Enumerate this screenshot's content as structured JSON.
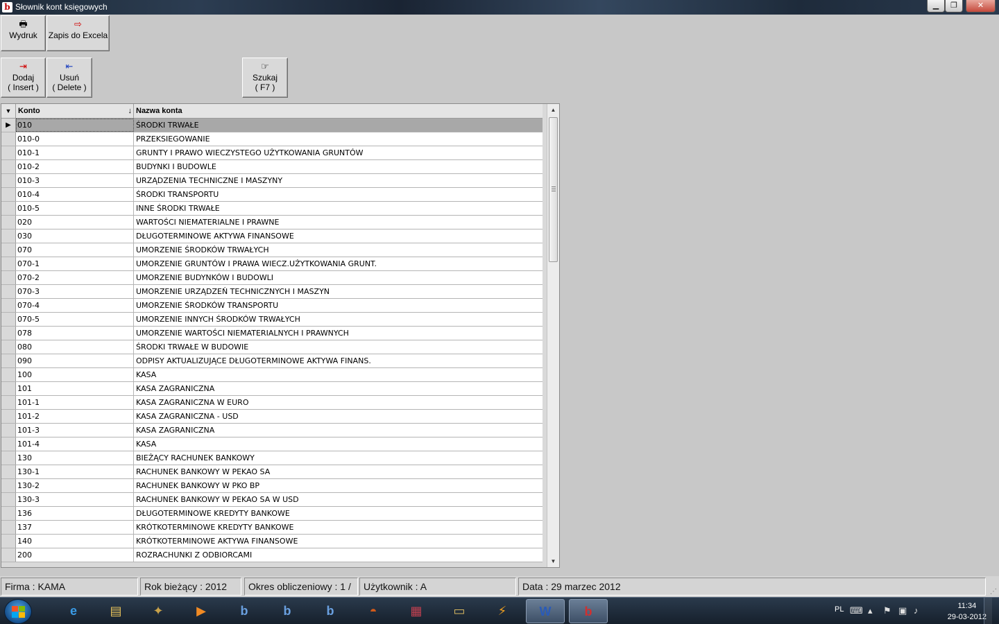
{
  "window": {
    "title": "Słownik kont księgowych",
    "app_icon": "b",
    "controls": {
      "minimize": "▁",
      "maximize": "❐",
      "close": "✕"
    }
  },
  "toolbar_top": [
    {
      "id": "print",
      "label": "Wydruk",
      "icon": "printer-icon",
      "glyph": "🖶"
    },
    {
      "id": "excel",
      "label": "Zapis do Excela",
      "icon": "export-excel-icon",
      "glyph": "⇨"
    }
  ],
  "toolbar_edit": [
    {
      "id": "add",
      "line1": "Dodaj",
      "line2": "( Insert )",
      "icon": "add-row-icon",
      "glyph": "⇥"
    },
    {
      "id": "delete",
      "line1": "Usuń",
      "line2": "( Delete )",
      "icon": "delete-row-icon",
      "glyph": "⇤"
    },
    {
      "id": "search",
      "line1": "Szukaj",
      "line2": "( F7 )",
      "icon": "search-hand-icon",
      "glyph": "☞"
    }
  ],
  "grid": {
    "header_indicator": "▼",
    "columns": [
      "Konto",
      "Nazwa konta"
    ],
    "sort_icon": "↓",
    "rows": [
      {
        "konto": "010",
        "nazwa": "ŚRODKI TRWAŁE",
        "selected": true
      },
      {
        "konto": "010-0",
        "nazwa": "PRZEKSIEGOWANIE"
      },
      {
        "konto": "010-1",
        "nazwa": "GRUNTY I PRAWO WIECZYSTEGO UŻYTKOWANIA GRUNTÓW"
      },
      {
        "konto": "010-2",
        "nazwa": "BUDYNKI I BUDOWLE"
      },
      {
        "konto": "010-3",
        "nazwa": "URZĄDZENIA TECHNICZNE I MASZYNY"
      },
      {
        "konto": "010-4",
        "nazwa": "ŚRODKI TRANSPORTU"
      },
      {
        "konto": "010-5",
        "nazwa": "INNE ŚRODKI TRWAŁE"
      },
      {
        "konto": "020",
        "nazwa": "WARTOŚCI NIEMATERIALNE I PRAWNE"
      },
      {
        "konto": "030",
        "nazwa": "DŁUGOTERMINOWE AKTYWA FINANSOWE"
      },
      {
        "konto": "070",
        "nazwa": "UMORZENIE ŚRODKÓW TRWAŁYCH"
      },
      {
        "konto": "070-1",
        "nazwa": "UMORZENIE GRUNTÓW I PRAWA WIECZ.UŻYTKOWANIA GRUNT."
      },
      {
        "konto": "070-2",
        "nazwa": "UMORZENIE BUDYNKÓW I BUDOWLI"
      },
      {
        "konto": "070-3",
        "nazwa": "UMORZENIE URZĄDZEŃ TECHNICZNYCH I MASZYN"
      },
      {
        "konto": "070-4",
        "nazwa": "UMORZENIE ŚRODKÓW TRANSPORTU"
      },
      {
        "konto": "070-5",
        "nazwa": "UMORZENIE INNYCH ŚRODKÓW TRWAŁYCH"
      },
      {
        "konto": "078",
        "nazwa": "UMORZENIE WARTOŚCI NIEMATERIALNYCH I PRAWNYCH"
      },
      {
        "konto": "080",
        "nazwa": "ŚRODKI TRWAŁE W BUDOWIE"
      },
      {
        "konto": "090",
        "nazwa": "ODPISY AKTUALIZUJĄCE DŁUGOTERMINOWE AKTYWA FINANS."
      },
      {
        "konto": "100",
        "nazwa": "KASA"
      },
      {
        "konto": "101",
        "nazwa": "KASA ZAGRANICZNA"
      },
      {
        "konto": "101-1",
        "nazwa": "KASA ZAGRANICZNA W EURO"
      },
      {
        "konto": "101-2",
        "nazwa": "KASA ZAGRANICZNA - USD"
      },
      {
        "konto": "101-3",
        "nazwa": "KASA ZAGRANICZNA"
      },
      {
        "konto": "101-4",
        "nazwa": "KASA"
      },
      {
        "konto": "130",
        "nazwa": "BIEŻĄCY RACHUNEK BANKOWY"
      },
      {
        "konto": "130-1",
        "nazwa": "RACHUNEK BANKOWY W PEKAO SA"
      },
      {
        "konto": "130-2",
        "nazwa": "RACHUNEK BANKOWY W PKO BP"
      },
      {
        "konto": "130-3",
        "nazwa": "RACHUNEK BANKOWY W PEKAO SA W USD"
      },
      {
        "konto": "136",
        "nazwa": "DŁUGOTERMINOWE KREDYTY BANKOWE"
      },
      {
        "konto": "137",
        "nazwa": "KRÓTKOTERMINOWE KREDYTY BANKOWE"
      },
      {
        "konto": "140",
        "nazwa": "KRÓTKOTERMINOWE AKTYWA FINANSOWE"
      },
      {
        "konto": "200",
        "nazwa": "ROZRACHUNKI Z ODBIORCAMI"
      }
    ]
  },
  "statusbar": {
    "firma": "Firma : KAMA",
    "rok": "Rok bieżący : 2012",
    "okres": "Okres obliczeniowy : 1 /",
    "uzytkownik": "Użytkownik : A",
    "data": "Data : 29 marzec 2012"
  },
  "taskbar": {
    "apps": [
      {
        "name": "ie-icon",
        "glyph": "e",
        "color": "#3a9be6"
      },
      {
        "name": "file-explorer-icon",
        "glyph": "▤",
        "color": "#e8c25a"
      },
      {
        "name": "dosbox-icon",
        "glyph": "✦",
        "color": "#c9a24a"
      },
      {
        "name": "media-player-icon",
        "glyph": "▶",
        "color": "#f08a24"
      },
      {
        "name": "app-b1-icon",
        "glyph": "b",
        "color": "#6aa0e0"
      },
      {
        "name": "app-b2-icon",
        "glyph": "b",
        "color": "#6aa0e0"
      },
      {
        "name": "app-b3-icon",
        "glyph": "b",
        "color": "#6aa0e0"
      },
      {
        "name": "helmet-icon",
        "glyph": "◓",
        "color": "#d05a1a"
      },
      {
        "name": "archive-icon",
        "glyph": "▦",
        "color": "#c04050"
      },
      {
        "name": "folder-icon",
        "glyph": "▭",
        "color": "#d8b860"
      },
      {
        "name": "winamp-icon",
        "glyph": "⚡",
        "color": "#f0a020"
      },
      {
        "name": "word-icon",
        "glyph": "W",
        "color": "#2a5bb8"
      },
      {
        "name": "app-b-active-icon",
        "glyph": "b",
        "color": "#d03030"
      }
    ],
    "lang": "PL",
    "time": "11:34",
    "date": "29-03-2012"
  }
}
